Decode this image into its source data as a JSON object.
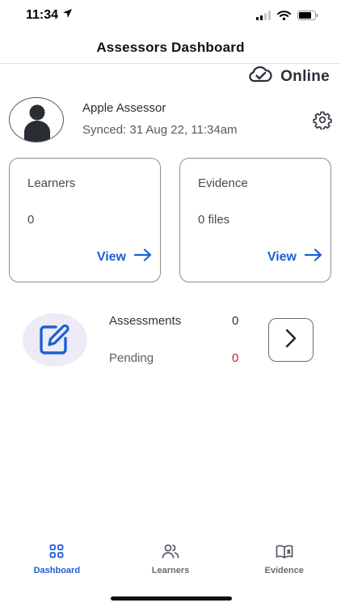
{
  "status": {
    "time": "11:34",
    "icons": [
      "location-arrow-icon",
      "signal-icon",
      "wifi-icon",
      "battery-icon"
    ]
  },
  "header": {
    "title": "Assessors Dashboard"
  },
  "connection": {
    "label": "Online",
    "icon": "cloud-check-icon"
  },
  "profile": {
    "name": "Apple Assessor",
    "synced": "Synced: 31 Aug 22, 11:34am"
  },
  "cards": {
    "learners": {
      "title": "Learners",
      "value": "0",
      "view_label": "View"
    },
    "evidence": {
      "title": "Evidence",
      "value": "0 files",
      "view_label": "View"
    }
  },
  "assessments": {
    "label": "Assessments",
    "count": "0",
    "pending_label": "Pending",
    "pending_count": "0"
  },
  "tabs": [
    {
      "label": "Dashboard",
      "icon": "grid-icon",
      "active": true
    },
    {
      "label": "Learners",
      "icon": "users-icon",
      "active": false
    },
    {
      "label": "Evidence",
      "icon": "book-icon",
      "active": false
    }
  ],
  "colors": {
    "accent": "#1d5fd3",
    "pending": "#c0202f",
    "icon_bg": "#ecebf6"
  }
}
